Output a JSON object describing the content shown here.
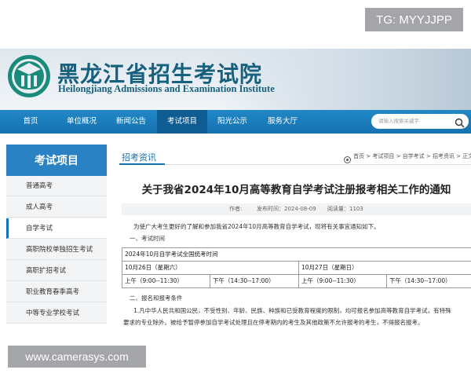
{
  "watermarks": {
    "top": "TG: MYYJJPP",
    "bottom": "www.camerasys.com"
  },
  "header": {
    "title_zh": "黑龙江省招生考试院",
    "title_en": "Heilongjiang Admissions and Examination Institute"
  },
  "nav": {
    "items": [
      {
        "label": "首页"
      },
      {
        "label": "单位概况"
      },
      {
        "label": "新闻公告"
      },
      {
        "label": "考试项目",
        "active": true
      },
      {
        "label": "阳光公示"
      },
      {
        "label": "服务大厅"
      }
    ],
    "search_placeholder": "请输入搜索关键字"
  },
  "sidebar": {
    "heading": "考试项目",
    "items": [
      {
        "label": "普通高考"
      },
      {
        "label": "成人高考"
      },
      {
        "label": "自学考试",
        "selected": true
      },
      {
        "label": "高职院校单独招生考试"
      },
      {
        "label": "高职扩招考试"
      },
      {
        "label": "职业教育春季高考"
      },
      {
        "label": "中等专业学校考试"
      }
    ]
  },
  "main": {
    "section_title": "招考资讯",
    "breadcrumb": "首页 > 考试项目 > 自学考试 > 招考资讯 > 正文",
    "article": {
      "title": "关于我省2024年10月高等教育自学考试注册报考相关工作的通知",
      "author_label": "作者:",
      "date": "发布时间：2024-08-09",
      "views": "阅读量：1103",
      "intro": "为使广大考生更好的了解和参加我省2024年10月高等教育自学考试，现将有关事宜通知如下。",
      "section1": "一、考试时间",
      "table": {
        "header": "2024年10月自学考试全国统考时间",
        "day1": "10月26日（星期六）",
        "day2": "10月27日（星期日）",
        "slots": [
          "上午（9:00--11:30）",
          "下午（14:30--17:00）",
          "上午（9:00--11:30）",
          "下午（14:30--17:00）"
        ]
      },
      "section2": "二、报名和报考条件",
      "para1": "1.凡中华人民共和国公民，不受性别、年龄、民族、种族和已受教育程度的限制，均可报名参加高等教育自学考试，有特殊",
      "para2": "要求的专业除外。被给予暂停参加自学考试处理且在停考期内的考生及其他政策不允许报考的考生，不得报名报考。"
    }
  },
  "colors": {
    "brand": "#1572b0",
    "nav_active": "#0f5c93",
    "sidebar_head": "#2a81c4",
    "title_text": "#17607e"
  }
}
